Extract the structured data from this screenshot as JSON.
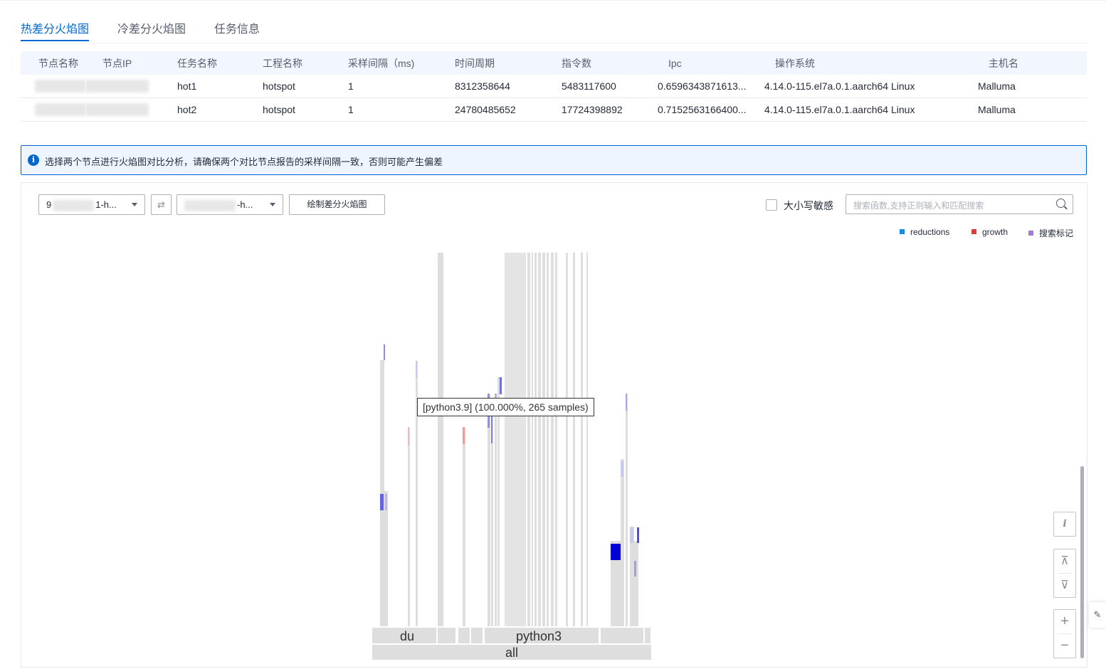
{
  "tabs": [
    {
      "label": "热差分火焰图",
      "active": true
    },
    {
      "label": "冷差分火焰图",
      "active": false
    },
    {
      "label": "任务信息",
      "active": false
    }
  ],
  "table": {
    "headers": [
      "节点名称",
      "节点IP",
      "任务名称",
      "工程名称",
      "采样间隔（ms)",
      "时间周期",
      "指令数",
      "Ipc",
      "操作系统",
      "主机名"
    ],
    "rows": [
      {
        "task": "hot1",
        "project": "hotspot",
        "interval": "1",
        "period": "8312358644",
        "instructions": "5483117600",
        "ipc": "0.6596343871613...",
        "os": "4.14.0-115.el7a.0.1.aarch64 Linux",
        "host": "Malluma"
      },
      {
        "task": "hot2",
        "project": "hotspot",
        "interval": "1",
        "period": "24780485652",
        "instructions": "17724398892",
        "ipc": "0.7152563166400...",
        "os": "4.14.0-115.el7a.0.1.aarch64 Linux",
        "host": "Malluma"
      }
    ]
  },
  "notice": {
    "text": "选择两个节点进行火焰图对比分析，请确保两个对比节点报告的采样间隔一致，否则可能产生偏差",
    "icon": "info-icon"
  },
  "toolbar": {
    "select1_value": "1-h...",
    "select1_prefix": "9",
    "select2_value": "-h...",
    "draw_button": "绘制差分火焰图",
    "case_sensitive_label": "大小写敏感",
    "search_placeholder": "搜索函数,支持正则输入和匹配搜索"
  },
  "legend": [
    {
      "label": "reductions",
      "color": "#1e88e5"
    },
    {
      "label": "growth",
      "color": "#e53935"
    },
    {
      "label": "搜索标记",
      "color": "#a778d8"
    }
  ],
  "flame": {
    "root_label": "all",
    "frame_labels": [
      "du",
      "python3"
    ],
    "tooltip": "[python3.9] (100.000%, 265 samples)"
  },
  "controls": {
    "info": "i",
    "expand_up": "⊼",
    "expand_down": "⊽",
    "zoom_in": "+",
    "zoom_out": "−"
  },
  "colors": {
    "accent": "#0067d1",
    "frame": "#dedede",
    "reduction_strong": "#0000d8"
  }
}
